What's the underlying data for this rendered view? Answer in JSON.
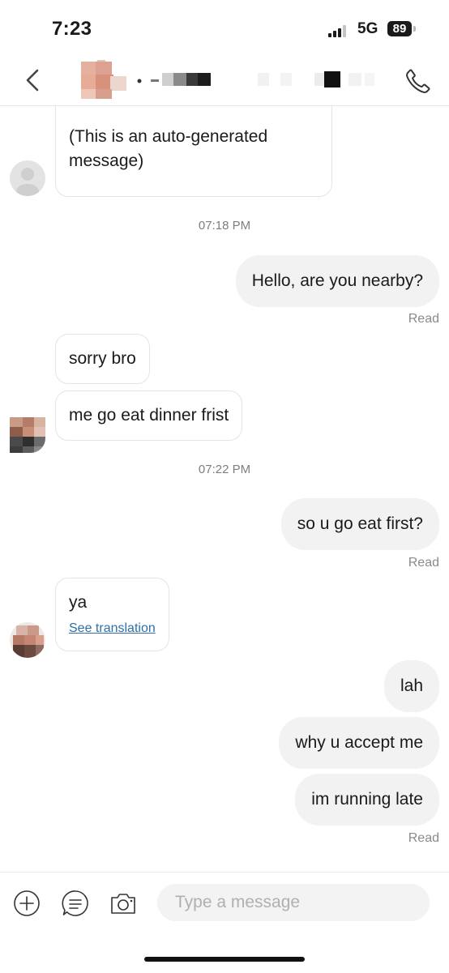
{
  "status_bar": {
    "time": "7:23",
    "network": "5G",
    "battery": "89"
  },
  "header": {
    "back_icon": "chevron-left-icon",
    "call_icon": "phone-icon"
  },
  "messages": [
    {
      "id": "m1",
      "text": "(This is an auto-generated message)"
    },
    {
      "id": "ts1",
      "text": "07:18 PM"
    },
    {
      "id": "m2",
      "text": "Hello, are you nearby?"
    },
    {
      "id": "r1",
      "text": "Read"
    },
    {
      "id": "m3",
      "text": "sorry bro"
    },
    {
      "id": "m4",
      "text": "me go eat dinner frist"
    },
    {
      "id": "ts2",
      "text": "07:22 PM"
    },
    {
      "id": "m5",
      "text": "so u go eat first?"
    },
    {
      "id": "r2",
      "text": "Read"
    },
    {
      "id": "m6",
      "text": "ya",
      "translation_link": "See translation"
    },
    {
      "id": "m7",
      "text": "lah"
    },
    {
      "id": "m8",
      "text": "why u accept me"
    },
    {
      "id": "m9",
      "text": "im running late"
    },
    {
      "id": "r3",
      "text": "Read"
    }
  ],
  "composer": {
    "placeholder": "Type a message",
    "icons": [
      "plus-circle-icon",
      "quick-reply-icon",
      "camera-icon"
    ]
  },
  "colors": {
    "outgoing_bubble": "#f2f2f2",
    "link": "#2f6fa6",
    "meta_text": "#8a8a8a"
  }
}
